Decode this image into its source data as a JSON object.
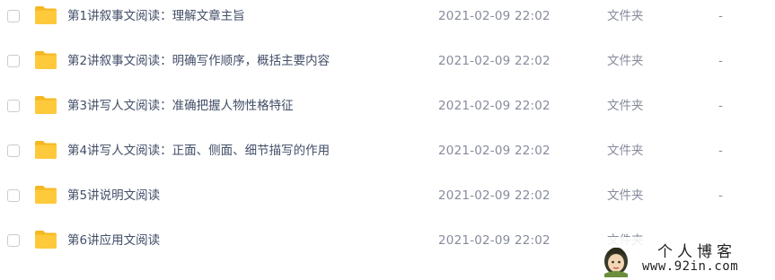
{
  "files": [
    {
      "name": "第1讲叙事文阅读：理解文章主旨",
      "date": "2021-02-09 22:02",
      "type": "文件夹",
      "size": "-"
    },
    {
      "name": "第2讲叙事文阅读：明确写作顺序，概括主要内容",
      "date": "2021-02-09 22:02",
      "type": "文件夹",
      "size": "-"
    },
    {
      "name": "第3讲写人文阅读：准确把握人物性格特征",
      "date": "2021-02-09 22:02",
      "type": "文件夹",
      "size": "-"
    },
    {
      "name": "第4讲写人文阅读：正面、侧面、细节描写的作用",
      "date": "2021-02-09 22:02",
      "type": "文件夹",
      "size": "-"
    },
    {
      "name": "第5讲说明文阅读",
      "date": "2021-02-09 22:02",
      "type": "文件夹",
      "size": "-"
    },
    {
      "name": "第6讲应用文阅读",
      "date": "2021-02-09 22:02",
      "type": "文件夹",
      "size": "-"
    }
  ],
  "watermark": {
    "title": "个人博客",
    "url": "www.92in.com"
  },
  "colors": {
    "folder": "#ffc93c",
    "folder_back": "#f5b81f",
    "name_text": "#424e67",
    "meta_text": "#878c9c",
    "checkbox_border": "#c8ccd2"
  },
  "icons": {
    "folder": "folder-icon",
    "checkbox": "checkbox-icon",
    "avatar": "avatar-icon"
  }
}
